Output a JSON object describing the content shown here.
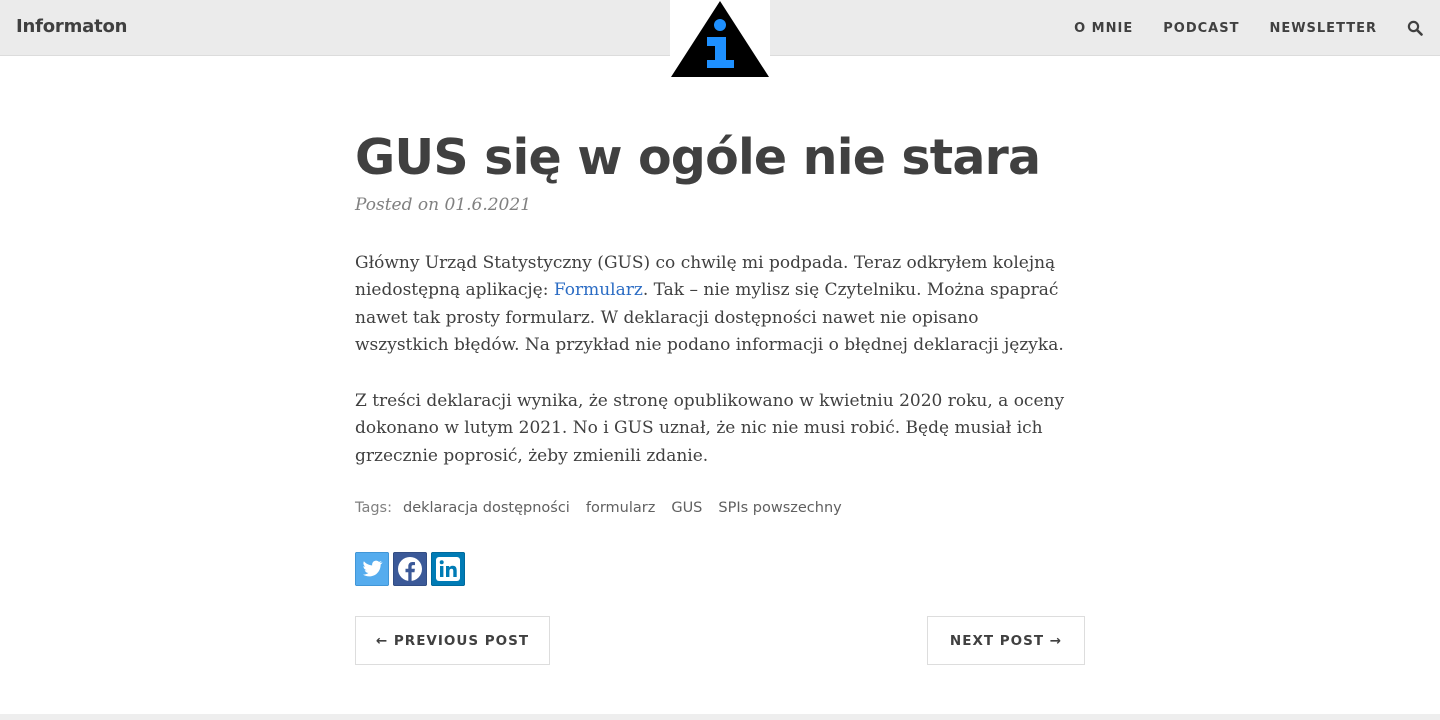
{
  "site": {
    "brand": "Informaton"
  },
  "nav": {
    "items": [
      "O MNIE",
      "PODCAST",
      "NEWSLETTER"
    ],
    "search_icon": "search-icon"
  },
  "logo": {
    "icon": "info-triangle-logo",
    "colors": {
      "triangle": "#000000",
      "letter": "#1e90ff"
    }
  },
  "post": {
    "title": "GUS się w ogóle nie stara",
    "meta_prefix": "Posted on",
    "date": "01.6.2021",
    "para1": {
      "text_before": "Główny Urząd Statystyczny (GUS) co chwilę mi podpada. Teraz odkryłem kolejną niedostępną aplikację: ",
      "link_text": "Formularz",
      "text_after": ". Tak – nie mylisz się Czytelniku. Można spaprać nawet tak prosty formularz. W deklaracji dostępności nawet nie opisano wszystkich błędów. Na przykład nie podano informacji o błędnej deklaracji języka."
    },
    "para2": "Z treści deklaracji wynika, że stronę opublikowano w kwietniu 2020 roku, a oceny dokonano w lutym 2021. No i GUS uznał, że nic nie musi robić. Będę musiał ich grzecznie poprosić, żeby zmienili zdanie.",
    "tags_label": "Tags:",
    "tags": [
      "deklaracja dostępności",
      "formularz",
      "GUS",
      "SPIs powszechny"
    ]
  },
  "share": {
    "buttons": [
      {
        "icon": "twitter-icon",
        "color": "#55acee"
      },
      {
        "icon": "facebook-icon",
        "color": "#3b5998"
      },
      {
        "icon": "linkedin-icon",
        "color": "#007bb5"
      }
    ]
  },
  "pager": {
    "previous": "← PREVIOUS POST",
    "next": "NEXT POST →"
  },
  "colors": {
    "link": "#2b6cc4",
    "navbar_bg": "#ebebeb",
    "text": "#404040",
    "meta": "#808080"
  }
}
